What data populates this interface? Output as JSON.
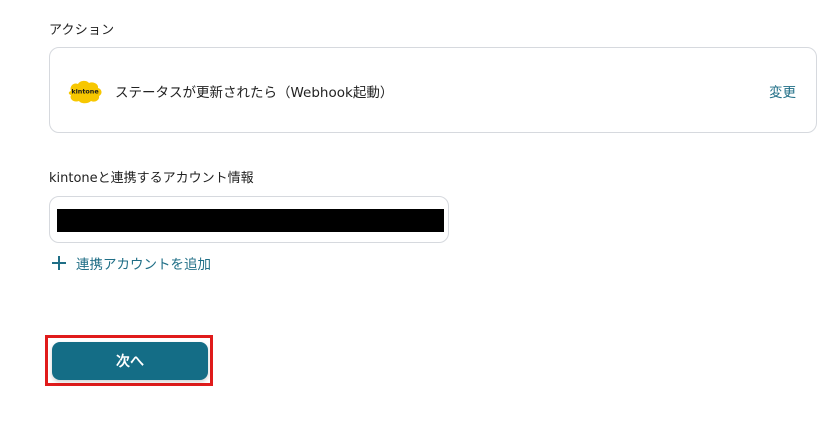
{
  "section": {
    "label": "アクション"
  },
  "action": {
    "app_icon": "kintone-logo",
    "logo_text": "kintone",
    "text": "ステータスが更新されたら（Webhook起動）",
    "change_label": "変更"
  },
  "account": {
    "label": "kintoneと連携するアカウント情報",
    "add_label": "連携アカウントを追加"
  },
  "footer": {
    "next_label": "次へ"
  },
  "colors": {
    "accent": "#146d86",
    "link": "#1f6e86",
    "highlight": "#e01b1b",
    "kintone_yellow": "#f7c700"
  }
}
